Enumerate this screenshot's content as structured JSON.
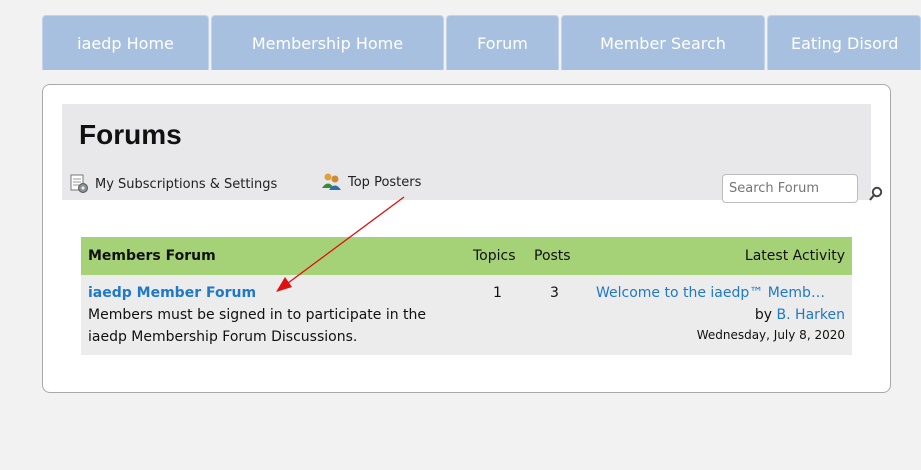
{
  "nav": {
    "tabs": [
      "iaedp Home",
      "Membership Home",
      "Forum",
      "Member Search",
      "Eating Disord"
    ]
  },
  "forums": {
    "title": "Forums",
    "subscriptions_label": "My Subscriptions & Settings",
    "top_posters_label": "Top Posters",
    "search_placeholder": "Search Forum"
  },
  "table": {
    "headers": {
      "forum": "Members Forum",
      "topics": "Topics",
      "posts": "Posts",
      "latest": "Latest Activity"
    },
    "rows": [
      {
        "title": "iaedp Member Forum",
        "description_line1": "Members must be signed in to participate in the",
        "description_line2": "iaedp Membership Forum Discussions.",
        "topics": "1",
        "posts": "3",
        "latest_title": "Welcome to the iaedp™ Memb…",
        "latest_by": "by",
        "latest_author": "B. Harken",
        "latest_date": "Wednesday, July 8, 2020"
      }
    ]
  },
  "colors": {
    "tab_bg": "#a8c0df",
    "header_green": "#a6d277",
    "link_blue": "#1f78c8",
    "arrow_red": "#e01010"
  },
  "icons": [
    "subscriptions-icon",
    "top-posters-icon",
    "search-icon"
  ]
}
